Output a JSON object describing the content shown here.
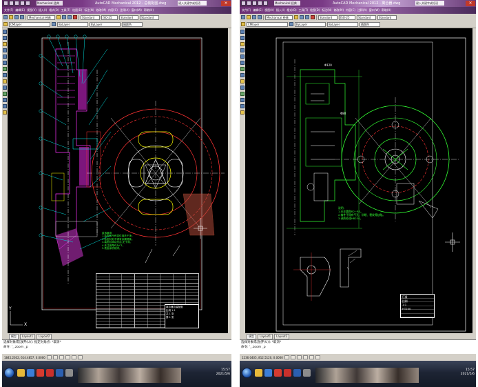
{
  "left_window": {
    "app_tab": "Mechanical 经典",
    "title": "AutoCAD Mechanical 2012 - 总装配图.dwg",
    "search_placeholder": "键入关键字或短语",
    "menus": [
      "文件(F)",
      "编辑(E)",
      "视图(V)",
      "插入(I)",
      "格式(O)",
      "工具(T)",
      "绘图(D)",
      "标注(N)",
      "修改(M)",
      "内容(C)",
      "注释(A)",
      "窗口(W)",
      "帮助(H)"
    ],
    "toolbar1": {
      "workspace": "Mechanical 经典",
      "style": "Standard",
      "dimstyle": "ISO-25",
      "textstyle": "Standard",
      "tablestyle": "Standard"
    },
    "toolbar2": {
      "layer": "CMlayer",
      "linetype": "ByLayer",
      "lineweight": "ByLayer",
      "color": "随颜色"
    },
    "layout_tabs": [
      "模型",
      "Layout1",
      "Layout2"
    ],
    "command_line1": "选择对象或[放弃(U)]: 指定对角点: *取消*",
    "command_line2": "命令: '_.zoom _p",
    "status_coords": "1845.2302, 614.4857, 0.0000",
    "tray_time": "15:57",
    "tray_date": "2021/5/6",
    "drawing": {
      "notes": [
        "技术要求",
        "1.装配前所有零件清洗干净。",
        "2.各密封处不得有渗漏现象。",
        "3.装配后转动灵活,无卡滞。",
        "4.未注倒角均为C1。",
        "5.表面涂防锈漆。"
      ],
      "title_block": [
        "离合器总装配图",
        "比例 1:1",
        "共 1 张",
        "第 1 张"
      ]
    }
  },
  "right_window": {
    "app_tab": "Mechanical 经典",
    "title": "AutoCAD Mechanical 2012 - 离合器.dwg",
    "search_placeholder": "键入关键字或短语",
    "menus": [
      "文件(F)",
      "编辑(E)",
      "视图(V)",
      "插入(I)",
      "格式(O)",
      "工具(T)",
      "绘图(D)",
      "标注(N)",
      "修改(M)",
      "内容(C)",
      "注释(A)",
      "窗口(W)",
      "帮助(H)"
    ],
    "toolbar1": {
      "workspace": "Mechanical 经典",
      "style": "Standard",
      "dimstyle": "ISO-25",
      "textstyle": "Standard",
      "tablestyle": "Standard"
    },
    "toolbar2": {
      "layer": "CMlayer",
      "linetype": "ByLayer",
      "lineweight": "ByLayer",
      "color": "随颜色"
    },
    "layout_tabs": [
      "模型",
      "Layout1",
      "Layout2"
    ],
    "command_line1": "选择对象或[放弃(U)]: *取消*",
    "command_line2": "命令: '_.zoom _p",
    "status_coords": "1236.0405, 812.5120, 0.0000",
    "tray_time": "15:57",
    "tray_date": "2021/5/6",
    "drawing": {
      "notes": [
        "说明:",
        "1.未注圆角R2~R3。",
        "2.铸件不得有气孔、砂眼、裂纹等缺陷。",
        "3.调质处理HB230。"
      ],
      "title_block": [
        "压盘",
        "比例",
        "1:1",
        "HT200"
      ]
    }
  }
}
